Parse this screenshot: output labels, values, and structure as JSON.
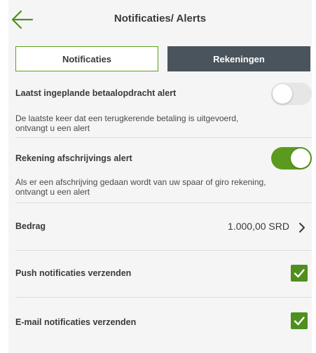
{
  "header": {
    "title": "Notificaties/ Alerts",
    "back_icon": "arrow-left-icon"
  },
  "segments": {
    "notificaties": "Notificaties",
    "rekeningen": "Rekeningen"
  },
  "settings": {
    "scheduled_alert": {
      "label": "Laatst ingeplande betaalopdracht alert",
      "description": "De laatste keer dat een terugkerende betaling is uitgevoerd, ontvangt u een alert",
      "enabled": false
    },
    "debit_alert": {
      "label": "Rekening afschrijvings alert",
      "description": "Als er een afschrijving gedaan wordt van uw spaar of giro rekening, ontvangt u een alert",
      "enabled": true
    },
    "amount": {
      "label": "Bedrag",
      "value": "1.000,00 SRD"
    },
    "push": {
      "label": "Push notificaties verzenden",
      "checked": true
    },
    "email": {
      "label": "E-mail notificaties verzenden",
      "checked": true
    }
  },
  "colors": {
    "accent_green": "#5a9b1f",
    "checkbox_green": "#4e8f1e",
    "tab_dark": "#4a545c"
  }
}
